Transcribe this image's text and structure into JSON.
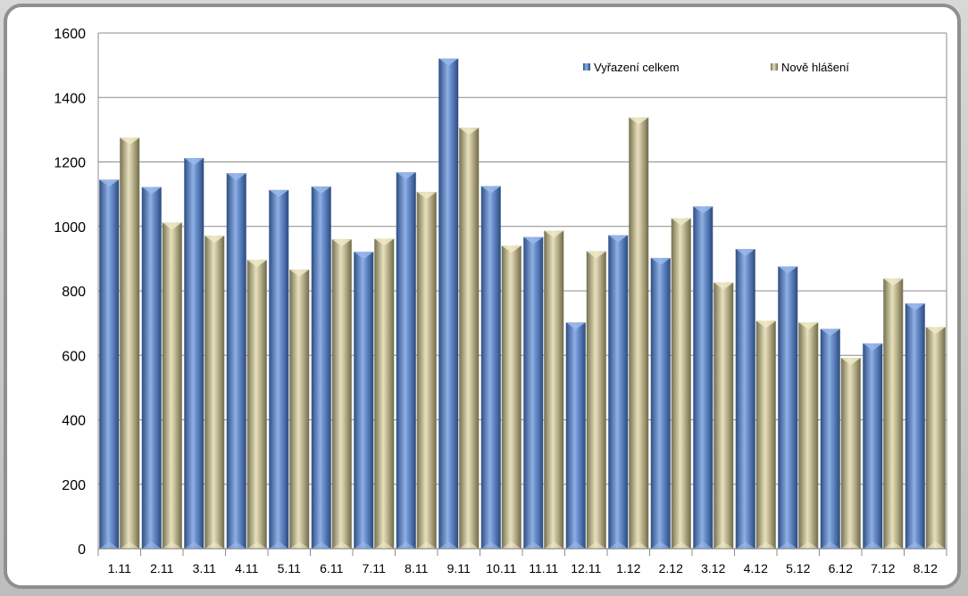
{
  "chart_data": {
    "type": "bar",
    "categories": [
      "1.11",
      "2.11",
      "3.11",
      "4.11",
      "5.11",
      "6.11",
      "7.11",
      "8.11",
      "9.11",
      "10.11",
      "11.11",
      "12.11",
      "1.12",
      "2.12",
      "3.12",
      "4.12",
      "5.12",
      "6.12",
      "7.12",
      "8.12"
    ],
    "series": [
      {
        "name": "Vyřazení celkem",
        "values": [
          1145,
          1122,
          1212,
          1165,
          1113,
          1124,
          921,
          1168,
          1521,
          1125,
          967,
          702,
          973,
          902,
          1062,
          930,
          876,
          682,
          637,
          761
        ],
        "color": "#5f86c4"
      },
      {
        "name": "Nově hlášení",
        "values": [
          1275,
          1012,
          971,
          896,
          866,
          960,
          962,
          1107,
          1306,
          940,
          987,
          923,
          1338,
          1025,
          826,
          707,
          702,
          592,
          838,
          688
        ],
        "color": "#c0b891"
      }
    ],
    "ylim": [
      0,
      1600
    ],
    "yticks": [
      "0",
      "200",
      "400",
      "600",
      "800",
      "1000",
      "1200",
      "1400",
      "1600"
    ],
    "grid": true,
    "legend_position": "top-right"
  }
}
